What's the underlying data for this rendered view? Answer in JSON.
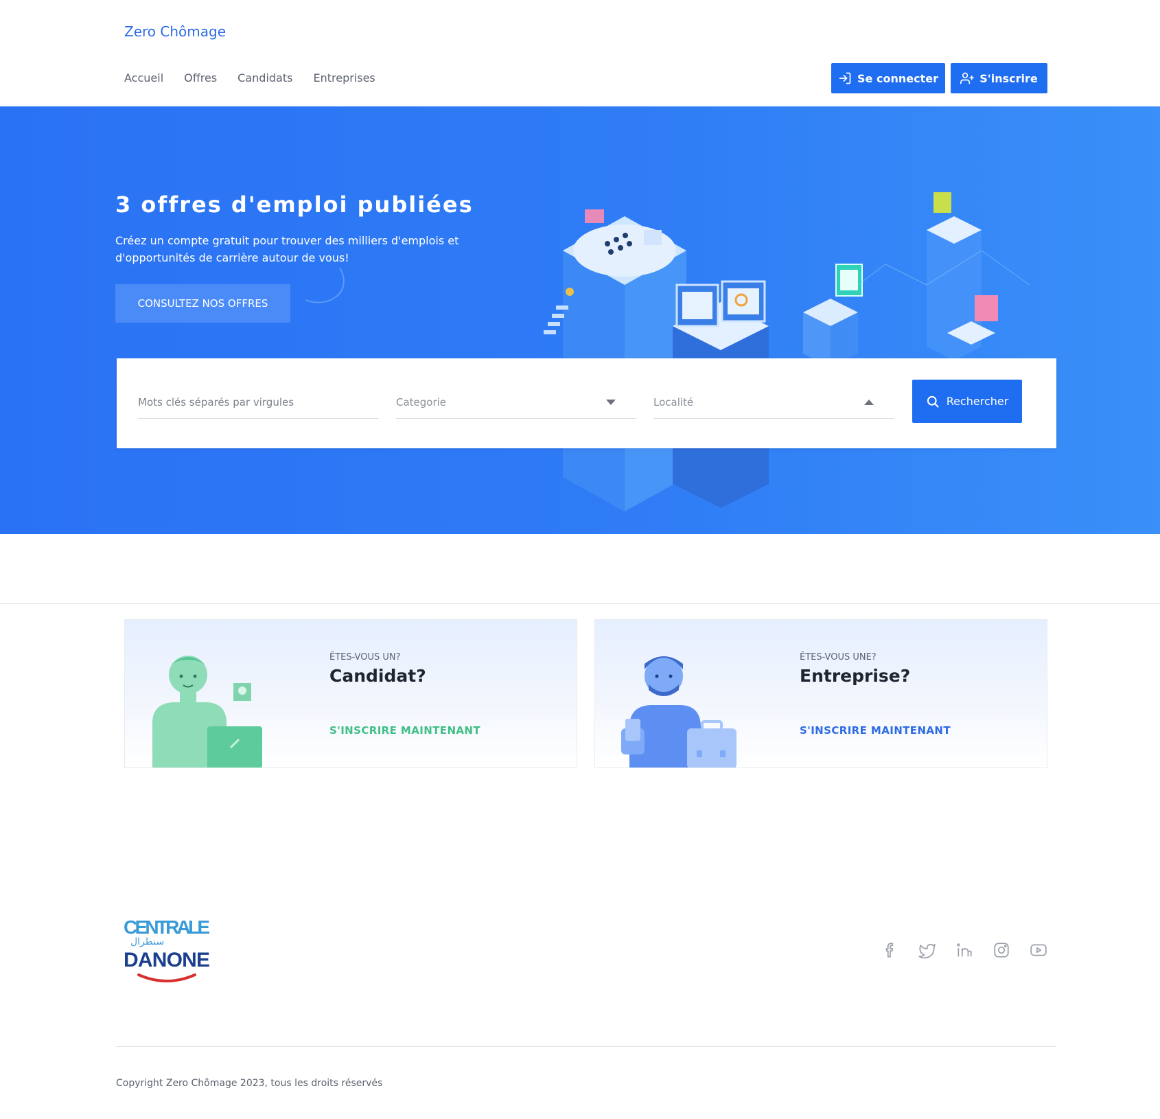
{
  "header": {
    "brand": "Zero Chômage",
    "nav": [
      "Accueil",
      "Offres",
      "Candidats",
      "Entreprises"
    ],
    "login_label": "Se connecter",
    "signup_label": "S'inscrire",
    "accent_color": "#1f6df0"
  },
  "hero": {
    "title": "3 offres d'emploi publiées",
    "subtitle": "Créez un compte gratuit pour trouver des milliers d'emplois et d'opportunités de carrière autour de vous!",
    "cta_label": "CONSULTEZ NOS OFFRES"
  },
  "search": {
    "keywords_placeholder": "Mots clés séparés par virgules",
    "keywords_value": "",
    "category_placeholder": "Categorie",
    "location_placeholder": "Localité",
    "button_label": "Rechercher"
  },
  "cards": {
    "candidat": {
      "pre": "ÊTES-VOUS UN?",
      "title": "Candidat?",
      "link": "S'INSCRIRE MAINTENANT",
      "link_color": "#3fbf86"
    },
    "entreprise": {
      "pre": "ÊTES-VOUS UNE?",
      "title": "Entreprise?",
      "link": "S'INSCRIRE MAINTENANT",
      "link_color": "#2d6be4"
    }
  },
  "footer": {
    "logo_text_top": "CENTRALE",
    "logo_text_arabic": "سنطرال",
    "logo_text_bottom": "DANONE",
    "socials": [
      "facebook-icon",
      "twitter-icon",
      "linkedin-icon",
      "instagram-icon",
      "youtube-icon"
    ],
    "copyright": "Copyright Zero Chômage 2023, tous les droits réservés"
  }
}
